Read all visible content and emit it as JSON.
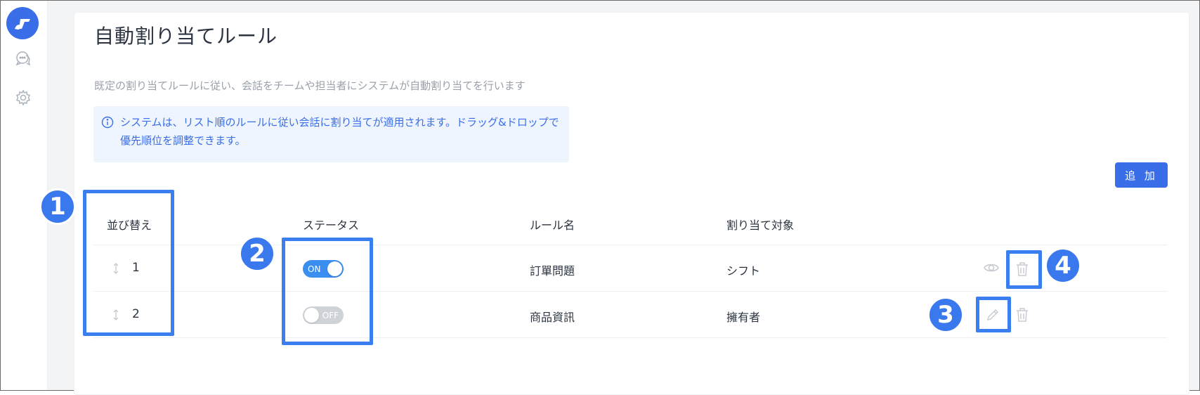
{
  "page": {
    "title": "自動割り当てルール",
    "description": "既定の割り当てルールに従い、会話をチームや担当者にシステムが自動割り当てを行います",
    "info": "システムは、リスト順のルールに従い会話に割り当てが適用されます。ドラッグ&ドロップで優先順位を調整できます。"
  },
  "sidebar": {
    "icons": [
      "logo-icon",
      "chat-icon",
      "settings-icon"
    ]
  },
  "toolbar": {
    "add_label": "追 加"
  },
  "table": {
    "headers": {
      "order": "並び替え",
      "status": "ステータス",
      "name": "ルール名",
      "target": "割り当て対象"
    },
    "rows": [
      {
        "order": "1",
        "status": "ON",
        "status_on": true,
        "name": "訂單問題",
        "target": "シフト"
      },
      {
        "order": "2",
        "status": "OFF",
        "status_on": false,
        "name": "商品資訊",
        "target": "擁有者"
      }
    ]
  },
  "annotations": {
    "badges": [
      "1",
      "2",
      "3",
      "4"
    ]
  },
  "colors": {
    "accent": "#3a6ee8",
    "highlight": "#3a7ef0",
    "info_bg": "#eef5ff"
  }
}
